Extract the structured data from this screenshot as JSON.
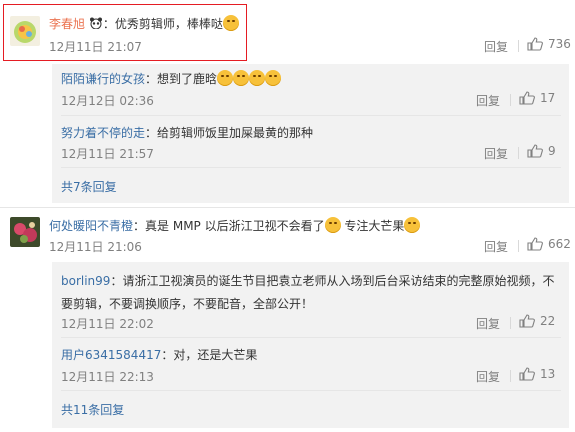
{
  "comments": [
    {
      "name": "李春旭",
      "sep": "：",
      "text": "优秀剪辑师，棒棒哒",
      "time": "12月11日 21:07",
      "reply": "回复",
      "likes": "736",
      "replies": [
        {
          "name": "陌陌谦行的女孩",
          "sep": "：",
          "text": "想到了鹿晗",
          "time": "12月12日 02:36",
          "reply": "回复",
          "likes": "17"
        },
        {
          "name": "努力着不停的走",
          "sep": "：",
          "text": "给剪辑师饭里加屎最黄的那种",
          "time": "12月11日 21:57",
          "reply": "回复",
          "likes": "9"
        }
      ],
      "more": "共7条回复"
    },
    {
      "name": "何处暖阳不青橙",
      "sep": "：",
      "text_a": "真是 MMP  以后浙江卫视不会看了",
      "text_b": " 专注大芒果",
      "time": "12月11日 21:06",
      "reply": "回复",
      "likes": "662",
      "replies": [
        {
          "name": "borlin99",
          "sep": "：",
          "text_l1": "请浙江卫视演员的诞生节目把袁立老师从入场到后台采访结束的完整原始视频，不",
          "text_l2": "要剪辑，不要调换顺序，不要配音，全部公开！",
          "time": "12月11日 22:02",
          "reply": "回复",
          "likes": "22"
        },
        {
          "name": "用户6341584417",
          "sep": "：",
          "text": "对，还是大芒果",
          "time": "12月11日 22:13",
          "reply": "回复",
          "likes": "13"
        }
      ],
      "more": "共11条回复"
    }
  ],
  "colors": {
    "name": "#eb7350",
    "link": "#3a6ea5",
    "highlight": "#e51c23",
    "panel": "#f2f2f2"
  },
  "icons": {
    "like": "thumbs-up-icon",
    "emoji": "smiley-emoji-icon",
    "badge": "panda-badge-icon"
  }
}
